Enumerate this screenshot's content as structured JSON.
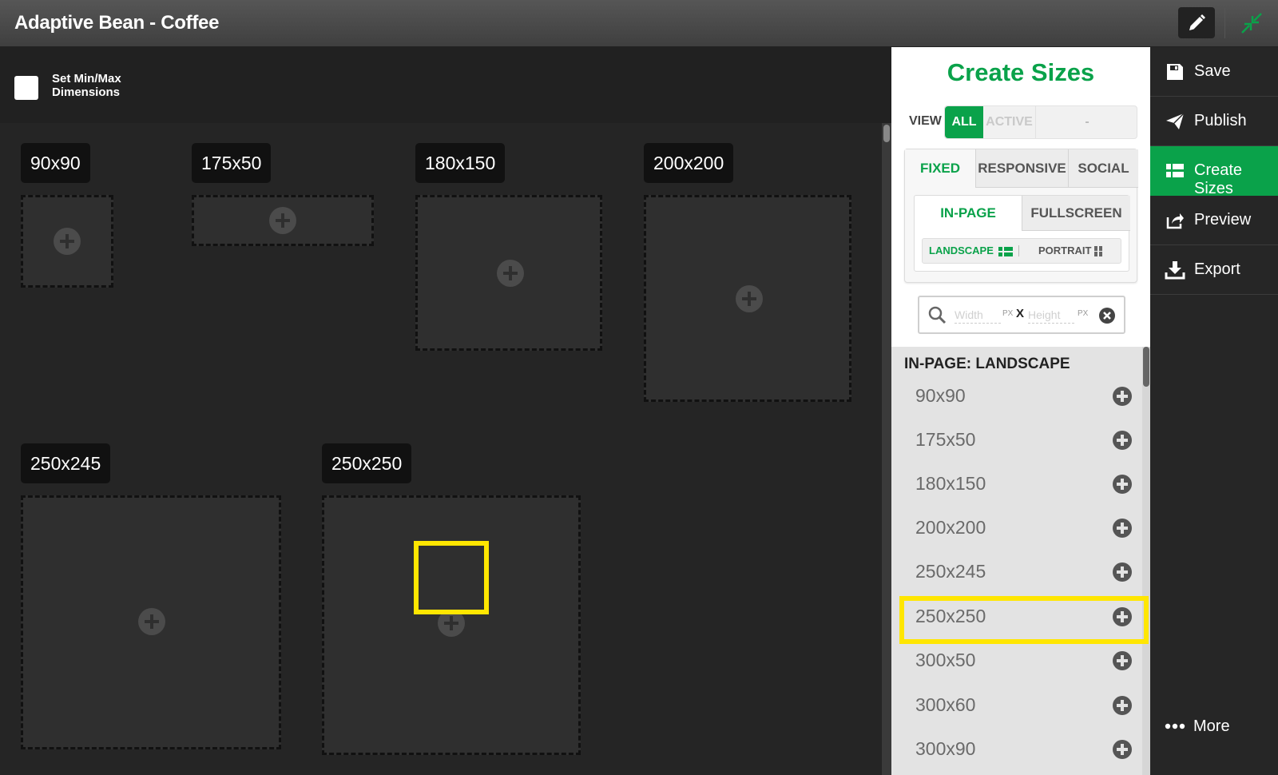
{
  "app": {
    "title": "Adaptive Bean - Coffee"
  },
  "canvas": {
    "minmax_label": "Set Min/Max Dimensions",
    "slots": [
      {
        "label": "90x90"
      },
      {
        "label": "175x50"
      },
      {
        "label": "180x150"
      },
      {
        "label": "200x200"
      },
      {
        "label": "250x245"
      },
      {
        "label": "250x250"
      }
    ]
  },
  "panel": {
    "title": "Create Sizes",
    "view_label": "VIEW",
    "view_options": {
      "all": "ALL",
      "active": "ACTIVE",
      "other": "-"
    },
    "type_tabs": {
      "fixed": "FIXED",
      "responsive": "RESPONSIVE",
      "social": "SOCIAL"
    },
    "placement_tabs": {
      "in_page": "IN-PAGE",
      "fullscreen": "FULLSCREEN"
    },
    "orientation": {
      "landscape": "LANDSCAPE",
      "portrait": "PORTRAIT"
    },
    "search": {
      "width_placeholder": "Width",
      "height_placeholder": "Height",
      "unit": "PX",
      "separator": "X"
    },
    "list_heading": "IN-PAGE: LANDSCAPE",
    "sizes": [
      "90x90",
      "175x50",
      "180x150",
      "200x200",
      "250x245",
      "250x250",
      "300x50",
      "300x60",
      "300x90"
    ]
  },
  "actions": {
    "save": "Save",
    "publish": "Publish",
    "create_sizes": "Create Sizes",
    "preview": "Preview",
    "export": "Export",
    "more": "More"
  },
  "colors": {
    "accent": "#0aa24a",
    "highlight": "#ffe600",
    "background": "#252525"
  }
}
